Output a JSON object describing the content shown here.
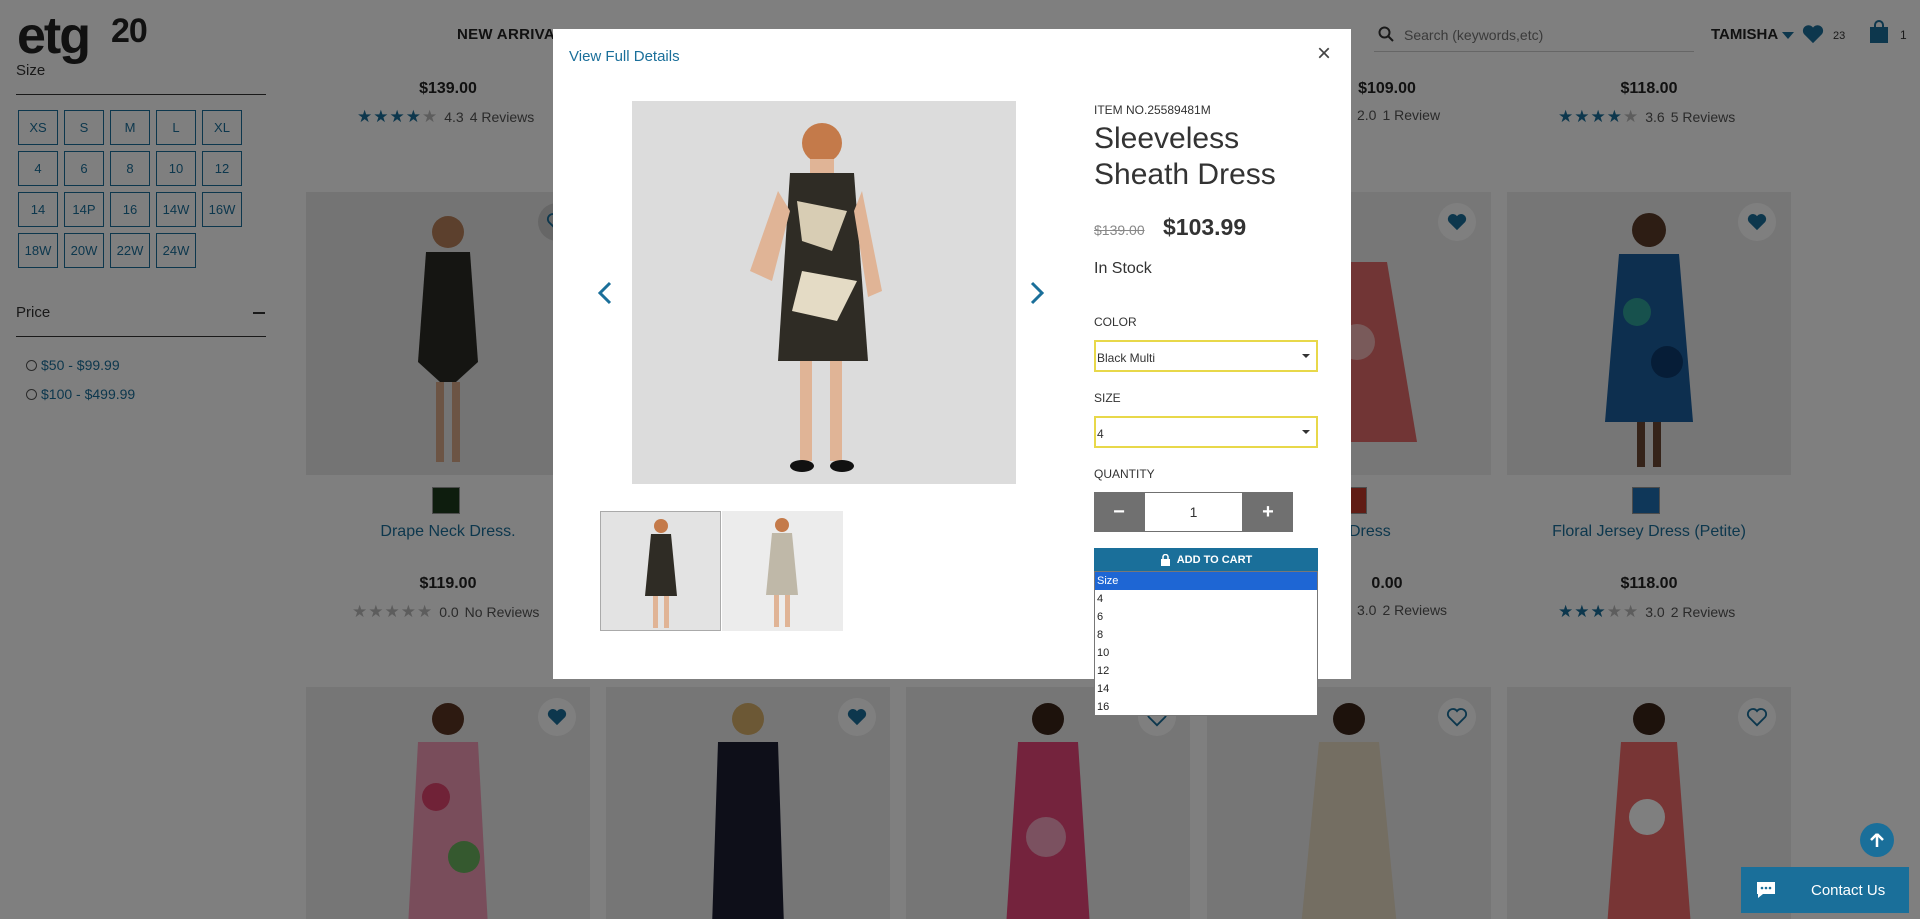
{
  "header": {
    "logo_text": "etg",
    "logo_badge": "20",
    "nav_new_arrivals": "NEW ARRIVALS",
    "search_placeholder": "Search (keywords,etc)",
    "user_name": "TAMISHA",
    "wishlist_count": "23",
    "cart_count": "1"
  },
  "sidebar": {
    "size_title": "Size",
    "sizes": [
      "XS",
      "S",
      "M",
      "L",
      "XL",
      "4",
      "6",
      "8",
      "10",
      "12",
      "14",
      "14P",
      "16",
      "14W",
      "16W",
      "18W",
      "20W",
      "22W",
      "24W"
    ],
    "price_title": "Price",
    "price_options": [
      "$50 - $99.99",
      "$100 - $499.99"
    ]
  },
  "grid": {
    "row1": [
      {
        "price": "$139.00",
        "rating": "4.3",
        "reviews": "4 Reviews"
      },
      {
        "price": "$109.00",
        "rating": "2.0",
        "reviews": "1 Review"
      },
      {
        "price": "$118.00",
        "rating": "3.6",
        "reviews": "5 Reviews"
      }
    ],
    "row2": [
      {
        "name": "Drape Neck Dress.",
        "price": "$119.00",
        "rating": "0.0",
        "reviews": "No Reviews",
        "swatch_color": "#1d3b1d"
      },
      {
        "name": "Dress",
        "price": "0.00",
        "rating": "3.0",
        "reviews": "2 Reviews",
        "swatch_color": "#c0392b"
      },
      {
        "name": "Floral Jersey Dress (Petite)",
        "price": "$118.00",
        "rating": "3.0",
        "reviews": "2 Reviews",
        "swatch_color": "#1f6fb3"
      }
    ]
  },
  "modal": {
    "view_full_details": "View Full Details",
    "close": "×",
    "item_no": "ITEM NO.25589481M",
    "title": "Sleeveless Sheath Dress",
    "old_price": "$139.00",
    "new_price": "$103.99",
    "stock": "In Stock",
    "color_label": "COLOR",
    "color_value": "Black Multi",
    "size_label": "SIZE",
    "size_value": "4",
    "quantity_label": "QUANTITY",
    "quantity_value": "1",
    "add_to_cart": "ADD TO CART"
  },
  "size_dropdown": {
    "options": [
      "Size",
      "4",
      "6",
      "8",
      "10",
      "12",
      "14",
      "16"
    ],
    "highlighted": "Size"
  },
  "contact": {
    "label": "Contact Us"
  },
  "colors": {
    "accent": "#1a6f9a",
    "highlight_select": "#e8d84a",
    "dropdown_selected": "#1e66d4"
  }
}
